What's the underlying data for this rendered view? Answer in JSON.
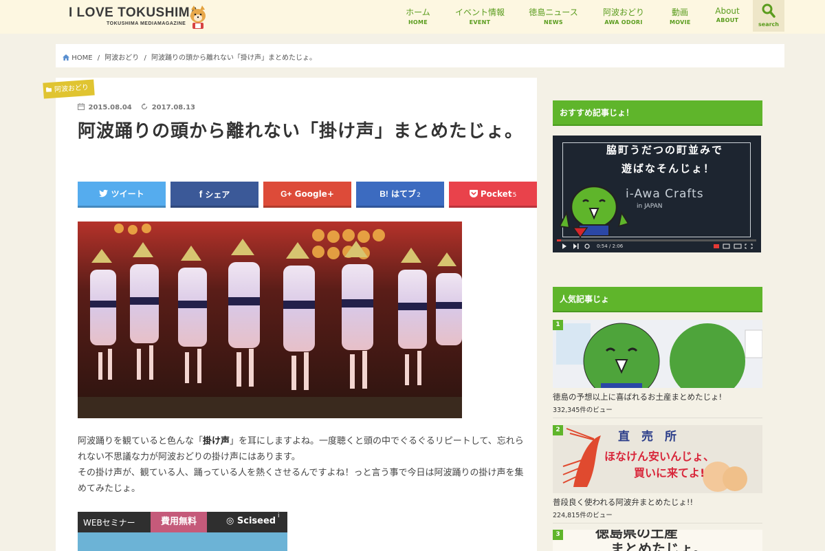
{
  "site": {
    "logo_main": "I LOVE TOKUSHIMA",
    "logo_sub": "TOKUSHIMA MEDIAMAGAZINE"
  },
  "nav": [
    {
      "jp": "ホーム",
      "en": "HOME"
    },
    {
      "jp": "イベント情報",
      "en": "EVENT"
    },
    {
      "jp": "徳島ニュース",
      "en": "NEWS"
    },
    {
      "jp": "阿波おどり",
      "en": "AWA ODORI"
    },
    {
      "jp": "動画",
      "en": "MOVIE"
    },
    {
      "jp": "About",
      "en": "ABOUT"
    }
  ],
  "search": {
    "label": "search"
  },
  "breadcrumb": {
    "home": "HOME",
    "sep": "/",
    "category": "阿波おどり",
    "current": "阿波踊りの頭から離れない「掛け声」まとめたじょ。"
  },
  "article": {
    "category": "阿波おどり",
    "published": "2015.08.04",
    "updated": "2017.08.13",
    "title": "阿波踊りの頭から離れない「掛け声」まとめたじょ。",
    "para1_a": "阿波踊りを観ていると色んな「",
    "para1_b": "掛け声",
    "para1_c": "」を耳にしますよね。一度聴くと頭の中でぐるぐるリピートして、忘れられない不思議な力が阿波おどりの掛け声にはあります。",
    "para2": "その掛け声が、観ている人、踊っている人を熱くさせるんですよね！っと言う事で今日は阿波踊りの掛け声を集めてみたじょ。"
  },
  "share": {
    "twitter": "ツイート",
    "facebook": "シェア",
    "google": "Google+",
    "hatena": "はてブ",
    "hatena_count": "2",
    "pocket": "Pocket",
    "pocket_count": "5"
  },
  "ad": {
    "web": "WEBセミナー",
    "free": "費用無料",
    "brand": "Sciseed",
    "info": "i"
  },
  "sidebar": {
    "recommend_heading": "おすすめ記事じょ！",
    "video": {
      "line1": "脇町うだつの町並みで",
      "line2": "遊ばなそんじょ！",
      "brand": "i-Awa Crafts",
      "sub": "in JAPAN",
      "time": "0:54 / 2:06",
      "progress": 0.02
    },
    "popular_heading": "人気記事じょ",
    "popular": [
      {
        "rank": "1",
        "title": "徳島の予想以上に喜ばれるお土産まとめたじょ!",
        "views": "332,345件のビュー"
      },
      {
        "rank": "2",
        "title": "普段良く使われる阿波弁まとめたじょ!!",
        "views": "224,815件のビュー",
        "sign_top": "直　売　所",
        "sign_mid": "ほなけん安いんじょ、",
        "sign_bot": "買いに来てよ!"
      },
      {
        "rank": "3",
        "sign_top": "徳島県の土産",
        "sign_bot": "まとめたじょ。"
      }
    ]
  },
  "colors": {
    "green": "#5fb52b",
    "nav_green": "#5a9c1e",
    "twitter": "#55acee",
    "facebook": "#3b5998",
    "google": "#dd4b39",
    "hatena": "#3c6bc0",
    "pocket": "#e9424b",
    "badge": "#e0c431",
    "header_bg": "#fdf7e1",
    "page_bg": "#f4f1e6"
  }
}
